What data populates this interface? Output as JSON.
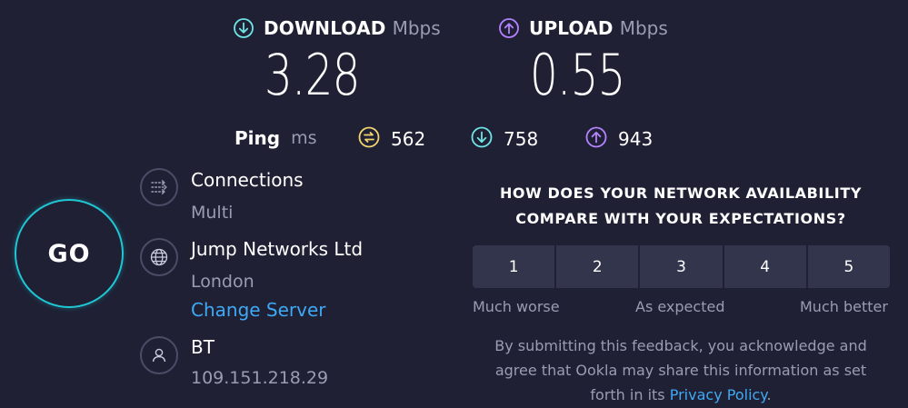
{
  "download": {
    "label": "DOWNLOAD",
    "unit": "Mbps",
    "value": "3.28",
    "icon": "download-arrow-icon",
    "color": "#6fe4e7"
  },
  "upload": {
    "label": "UPLOAD",
    "unit": "Mbps",
    "value": "0.55",
    "icon": "upload-arrow-icon",
    "color": "#b583ff"
  },
  "ping": {
    "label": "Ping",
    "unit": "ms",
    "idle": {
      "value": "562",
      "icon": "idle-latency-icon",
      "color": "#f2d56e"
    },
    "download": {
      "value": "758",
      "icon": "download-latency-icon",
      "color": "#6fe4e7"
    },
    "upload": {
      "value": "943",
      "icon": "upload-latency-icon",
      "color": "#b583ff"
    }
  },
  "go": {
    "label": "GO",
    "color": "#1fc7d4"
  },
  "connections": {
    "title": "Connections",
    "value": "Multi",
    "icon": "connections-icon"
  },
  "server": {
    "name": "Jump Networks Ltd",
    "location": "London",
    "change_label": "Change Server",
    "icon": "globe-icon"
  },
  "provider": {
    "name": "BT",
    "ip": "109.151.218.29",
    "icon": "user-icon"
  },
  "survey": {
    "question_line1": "HOW DOES YOUR NETWORK AVAILABILITY",
    "question_line2": "COMPARE WITH YOUR EXPECTATIONS?",
    "options": [
      "1",
      "2",
      "3",
      "4",
      "5"
    ],
    "scale_low": "Much worse",
    "scale_mid": "As expected",
    "scale_high": "Much better",
    "disclaimer_line1": "By submitting this feedback, you acknowledge and",
    "disclaimer_line2": "agree that Ookla may share this information as set",
    "disclaimer_line3_prefix": "forth in its",
    "privacy_link": "Privacy Policy",
    "disclaimer_line3_suffix": "."
  }
}
